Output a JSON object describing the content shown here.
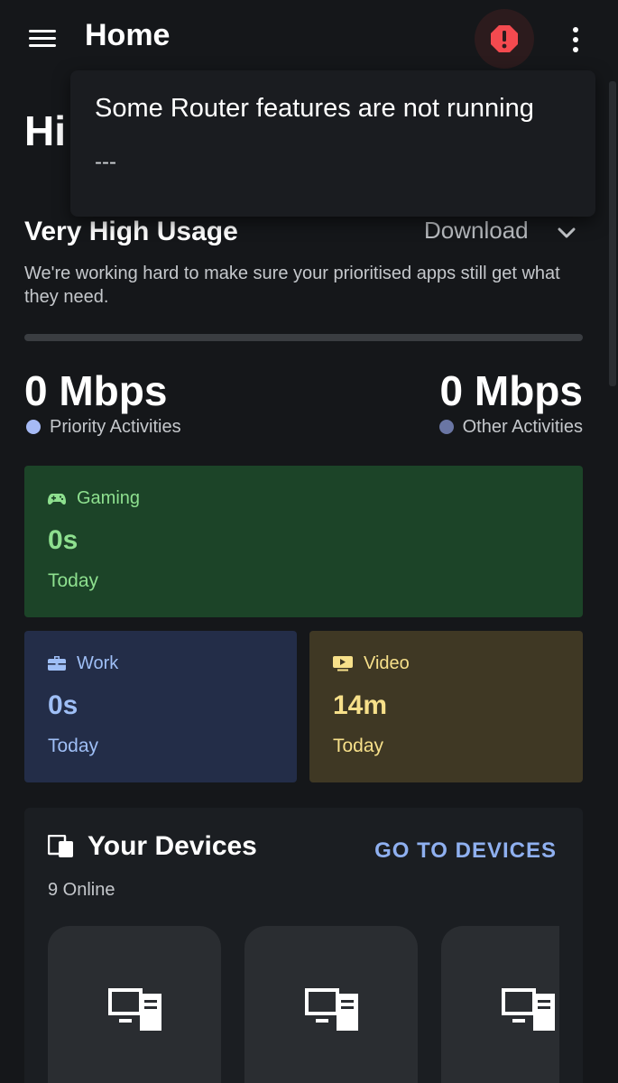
{
  "appbar": {
    "title": "Home",
    "menu_icon": "menu-icon",
    "alert_icon": "alert-octagon-icon",
    "more_icon": "more-vert-icon"
  },
  "greeting": "Hi",
  "popup": {
    "title": "Some Router features are not running",
    "subtitle": "---"
  },
  "usage": {
    "title": "Very High Usage",
    "direction": "Download",
    "description": "We're working hard to make sure your prioritised apps still get what they need."
  },
  "speeds": {
    "priority": {
      "value": "0 Mbps",
      "label": "Priority Activities",
      "dot_color": "#a6baf5"
    },
    "other": {
      "value": "0 Mbps",
      "label": "Other Activities",
      "dot_color": "#6a76a4"
    }
  },
  "activities": {
    "gaming": {
      "label": "Gaming",
      "value": "0s",
      "period": "Today",
      "icon": "gamepad-icon",
      "color": "#8ee08f"
    },
    "work": {
      "label": "Work",
      "value": "0s",
      "period": "Today",
      "icon": "briefcase-icon",
      "color": "#9fbff6"
    },
    "video": {
      "label": "Video",
      "value": "14m",
      "period": "Today",
      "icon": "video-icon",
      "color": "#f7e08a"
    }
  },
  "devices": {
    "title": "Your Devices",
    "link": "GO TO DEVICES",
    "count": "9 Online",
    "tiles": [
      "desktop-tower-icon",
      "desktop-tower-icon",
      "desktop-tower-icon"
    ]
  }
}
